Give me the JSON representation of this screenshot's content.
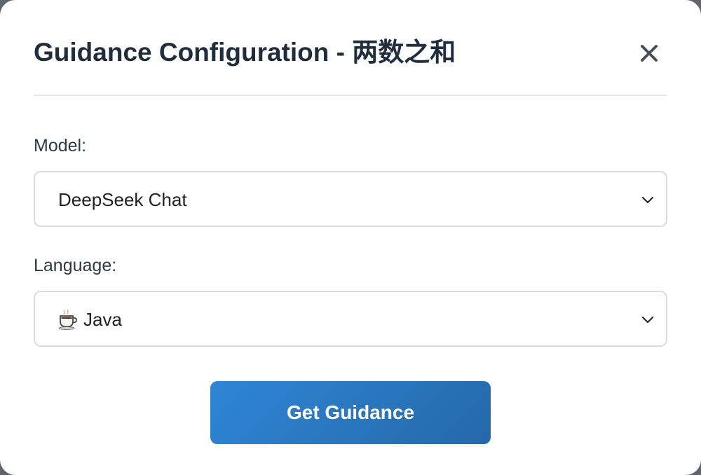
{
  "dialog": {
    "title": "Guidance Configuration - 两数之和"
  },
  "model": {
    "label": "Model:",
    "selected": "DeepSeek Chat"
  },
  "language": {
    "label": "Language:",
    "icon": "coffee-cup-icon",
    "selected": "Java"
  },
  "actions": {
    "submit_label": "Get Guidance"
  },
  "colors": {
    "title": "#1f2d3d",
    "button_gradient_start": "#2e86d6",
    "button_gradient_end": "#2568a8",
    "border": "#d9dde2"
  }
}
